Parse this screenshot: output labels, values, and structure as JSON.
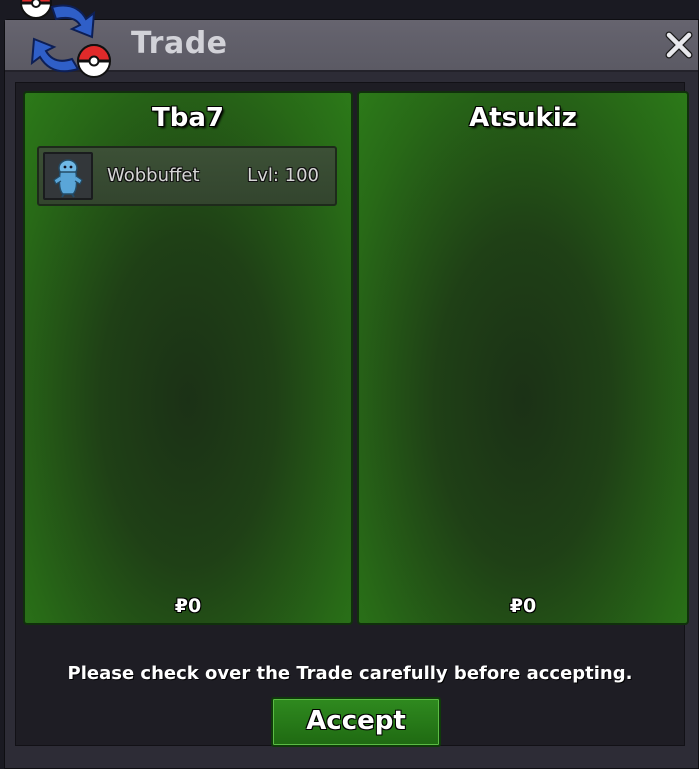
{
  "window": {
    "title": "Trade",
    "close_icon": "close-icon",
    "logo_icon": "trade-pokeball-arrows-icon"
  },
  "left_panel": {
    "trainer_name": "Tba7",
    "pokemon": [
      {
        "name": "Wobbuffet",
        "level": "Lvl: 100",
        "icon": "wobbuffet-sprite-icon"
      }
    ],
    "money": "₽0"
  },
  "right_panel": {
    "trainer_name": "Atsukiz",
    "pokemon": [],
    "money": "₽0"
  },
  "notice": "Please check over the Trade carefully before accepting.",
  "accept_label": "Accept",
  "colors": {
    "panel_green": "#286a17",
    "window_bg": "#2d2c36",
    "titlebar": "#5b5a64",
    "accept_button": "#2f8a1f"
  }
}
